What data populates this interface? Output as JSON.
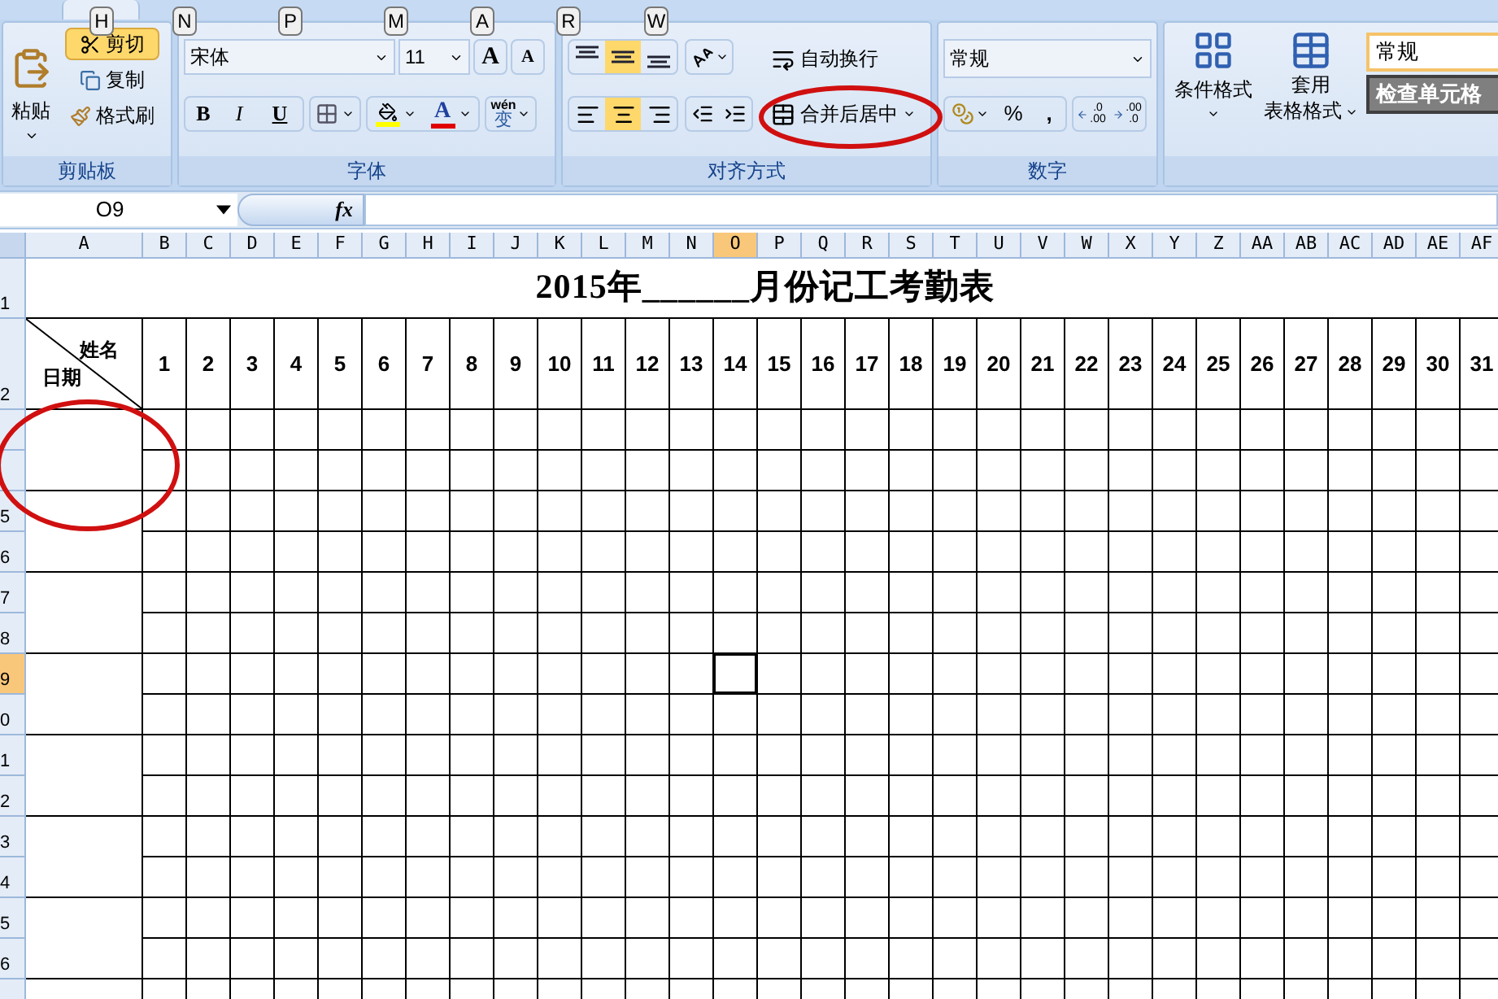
{
  "keytips": [
    "H",
    "N",
    "P",
    "M",
    "A",
    "R",
    "W"
  ],
  "clipboard": {
    "title": "剪贴板",
    "paste": "粘贴",
    "cut": {
      "label": "剪切",
      "selected": true
    },
    "copy": "复制",
    "format_painter": "格式刷"
  },
  "font": {
    "title": "字体",
    "font_name": "宋体",
    "font_size": "11",
    "grow_font": "A",
    "shrink_font": "A",
    "bold": "B",
    "italic": "I",
    "underline": "U",
    "font_color": "A",
    "phonetic": {
      "top": "wén",
      "bottom": "变"
    }
  },
  "alignment": {
    "title": "对齐方式",
    "vertical": [
      {
        "kind": "top",
        "selected": false
      },
      {
        "kind": "middle",
        "selected": true
      },
      {
        "kind": "bottom",
        "selected": false
      }
    ],
    "horizontal": [
      {
        "kind": "left",
        "selected": false
      },
      {
        "kind": "center",
        "selected": true
      },
      {
        "kind": "right",
        "selected": false
      }
    ],
    "wrap_text": "自动换行",
    "merge_center": "合并后居中"
  },
  "number": {
    "title": "数字",
    "format": "常规",
    "percent": "%",
    "comma": ",",
    "increase_decimal": {
      "top": ".0",
      "bottom": ".00"
    },
    "decrease_decimal": {
      "top": ".00",
      "bottom": ".0"
    }
  },
  "styles": {
    "conditional_format": "条件格式",
    "table_format": [
      "套用",
      "表格格式"
    ],
    "cell_styles": [
      {
        "label": "常规",
        "selected": true
      },
      {
        "label": "检查单元格",
        "selected": false
      }
    ]
  },
  "formula_bar": {
    "name_box": "O9",
    "function_button": "fx"
  },
  "sheet": {
    "title": "2015年______月份记工考勤表",
    "corner_top": "姓名",
    "corner_bottom": "日期",
    "days": [
      "1",
      "2",
      "3",
      "4",
      "5",
      "6",
      "7",
      "8",
      "9",
      "10",
      "11",
      "12",
      "13",
      "14",
      "15",
      "16",
      "17",
      "18",
      "19",
      "20",
      "21",
      "22",
      "23",
      "24",
      "25",
      "26",
      "27",
      "28",
      "29",
      "30",
      "31"
    ],
    "columns": [
      {
        "label": "A",
        "selected": false
      },
      {
        "label": "B",
        "selected": false
      },
      {
        "label": "C",
        "selected": false
      },
      {
        "label": "D",
        "selected": false
      },
      {
        "label": "E",
        "selected": false
      },
      {
        "label": "F",
        "selected": false
      },
      {
        "label": "G",
        "selected": false
      },
      {
        "label": "H",
        "selected": false
      },
      {
        "label": "I",
        "selected": false
      },
      {
        "label": "J",
        "selected": false
      },
      {
        "label": "K",
        "selected": false
      },
      {
        "label": "L",
        "selected": false
      },
      {
        "label": "M",
        "selected": false
      },
      {
        "label": "N",
        "selected": false
      },
      {
        "label": "O",
        "selected": true
      },
      {
        "label": "P",
        "selected": false
      },
      {
        "label": "Q",
        "selected": false
      },
      {
        "label": "R",
        "selected": false
      },
      {
        "label": "S",
        "selected": false
      },
      {
        "label": "T",
        "selected": false
      },
      {
        "label": "U",
        "selected": false
      },
      {
        "label": "V",
        "selected": false
      },
      {
        "label": "W",
        "selected": false
      },
      {
        "label": "X",
        "selected": false
      },
      {
        "label": "Y",
        "selected": false
      },
      {
        "label": "Z",
        "selected": false
      },
      {
        "label": "AA",
        "selected": false
      },
      {
        "label": "AB",
        "selected": false
      },
      {
        "label": "AC",
        "selected": false
      },
      {
        "label": "AD",
        "selected": false
      },
      {
        "label": "AE",
        "selected": false
      },
      {
        "label": "AF",
        "selected": false
      }
    ],
    "rows": [
      {
        "label": "1",
        "selected": false
      },
      {
        "label": "2",
        "selected": false
      },
      {
        "selected": false
      },
      {
        "selected": false
      },
      {
        "label": "5",
        "selected": false
      },
      {
        "label": "6",
        "selected": false
      },
      {
        "label": "7",
        "selected": false
      },
      {
        "label": "8",
        "selected": false
      },
      {
        "label": "9",
        "selected": true
      },
      {
        "label": "0",
        "selected": false
      },
      {
        "label": "1",
        "selected": false
      },
      {
        "label": "2",
        "selected": false
      },
      {
        "label": "3",
        "selected": false
      },
      {
        "label": "4",
        "selected": false
      },
      {
        "label": "5",
        "selected": false
      },
      {
        "label": "6",
        "selected": false
      },
      {
        "selected": false
      }
    ]
  }
}
